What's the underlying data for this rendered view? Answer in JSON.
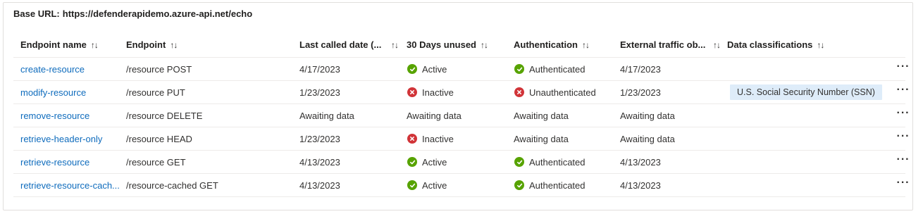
{
  "base_url": {
    "label": "Base URL:",
    "value": "https://defenderapidemo.azure-api.net/echo"
  },
  "columns": {
    "name": "Endpoint name",
    "endpoint": "Endpoint",
    "last_called": "Last called date (...",
    "unused": "30 Days unused",
    "auth": "Authentication",
    "external": "External traffic ob...",
    "classifications": "Data classifications"
  },
  "sort_glyph": "↑↓",
  "more_glyph": "···",
  "colors": {
    "link": "#0f6cbd",
    "ok": "#57a300",
    "bad": "#d13438",
    "chip": "#deecf9"
  },
  "rows": [
    {
      "name": "create-resource",
      "endpoint": "/resource POST",
      "last_called": "4/17/2023",
      "unused": "Active",
      "unused_icon": "check-icon",
      "auth": "Authenticated",
      "auth_icon": "check-icon",
      "external": "4/17/2023",
      "classification": ""
    },
    {
      "name": "modify-resource",
      "endpoint": "/resource PUT",
      "last_called": "1/23/2023",
      "unused": "Inactive",
      "unused_icon": "error-icon",
      "auth": "Unauthenticated",
      "auth_icon": "error-icon",
      "external": "1/23/2023",
      "classification": "U.S. Social Security Number (SSN)"
    },
    {
      "name": "remove-resource",
      "endpoint": "/resource DELETE",
      "last_called": "Awaiting data",
      "unused": "Awaiting data",
      "unused_icon": "",
      "auth": "Awaiting data",
      "auth_icon": "",
      "external": "Awaiting data",
      "classification": ""
    },
    {
      "name": "retrieve-header-only",
      "endpoint": "/resource HEAD",
      "last_called": "1/23/2023",
      "unused": "Inactive",
      "unused_icon": "error-icon",
      "auth": "Awaiting data",
      "auth_icon": "",
      "external": "Awaiting data",
      "classification": ""
    },
    {
      "name": "retrieve-resource",
      "endpoint": "/resource GET",
      "last_called": "4/13/2023",
      "unused": "Active",
      "unused_icon": "check-icon",
      "auth": "Authenticated",
      "auth_icon": "check-icon",
      "external": "4/13/2023",
      "classification": ""
    },
    {
      "name": "retrieve-resource-cach...",
      "endpoint": "/resource-cached GET",
      "last_called": "4/13/2023",
      "unused": "Active",
      "unused_icon": "check-icon",
      "auth": "Authenticated",
      "auth_icon": "check-icon",
      "external": "4/13/2023",
      "classification": ""
    }
  ]
}
